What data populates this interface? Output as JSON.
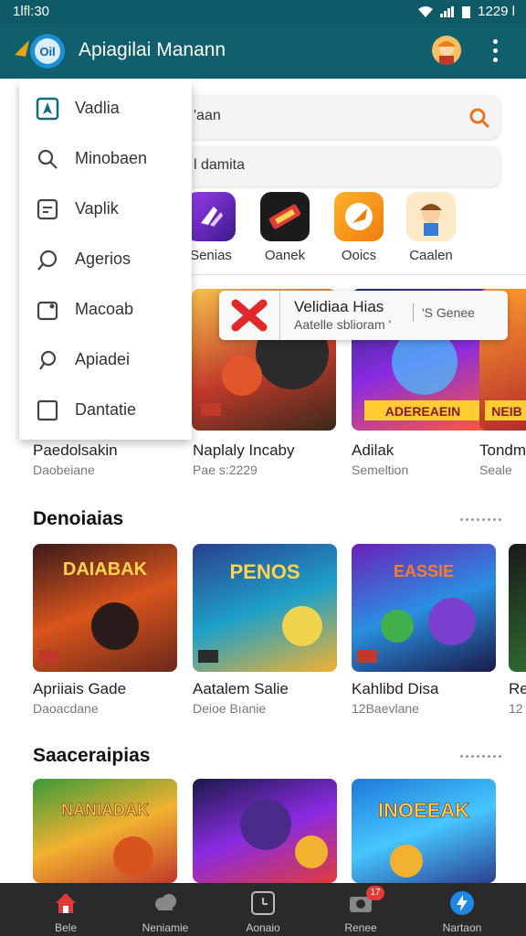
{
  "status_bar": {
    "time": "1lﬂ:30",
    "clock": "1229 l"
  },
  "app_bar": {
    "title": "Apiagilai Manann"
  },
  "search": {
    "query": "'aan",
    "secondary": "l damita"
  },
  "categories": [
    {
      "label": "Senias",
      "icon": "game-purple-icon",
      "color": "#7b2fd0"
    },
    {
      "label": "Oanek",
      "icon": "game-red-icon",
      "color": "#d6283b"
    },
    {
      "label": "Ooics",
      "icon": "rocket-icon",
      "color": "#f39c12"
    },
    {
      "label": "Caalen",
      "icon": "character-icon",
      "color": "#f2d7a7"
    }
  ],
  "drawer": {
    "items": [
      {
        "label": "Vadlia",
        "icon": "compass-icon"
      },
      {
        "label": "Minobaen",
        "icon": "search-icon"
      },
      {
        "label": "Vaplik",
        "icon": "file-icon"
      },
      {
        "label": "Agerios",
        "icon": "chat-icon"
      },
      {
        "label": "Macoab",
        "icon": "image-icon"
      },
      {
        "label": "Apiadei",
        "icon": "comment-icon"
      },
      {
        "label": "Dantatie",
        "icon": "square-icon"
      }
    ]
  },
  "toast": {
    "title": "Velidiaa Hias",
    "subtitle": "Aatelle sblioram '",
    "action": "'S Genee"
  },
  "row1": [
    {
      "name": "Paedolsakin",
      "sub": "Daobeiane"
    },
    {
      "name": "Naplaly Incaby",
      "sub": "Pae s:2229",
      "tag": "DDE"
    },
    {
      "name": "Adilak",
      "sub": "Semeltion",
      "banner": "ADEREAEIN"
    },
    {
      "name": "Tondm",
      "sub": "Seale",
      "banner": "NEIB"
    }
  ],
  "section2": {
    "title": "Denoiaias"
  },
  "row2": [
    {
      "name": "Apriiais Gade",
      "sub": "Daoacdane",
      "banner": "DAIABAK",
      "tag": "DDS"
    },
    {
      "name": "Aatalem Salie",
      "sub": "Deioe Bıanie",
      "banner": "PENOS",
      "tag": "DDC"
    },
    {
      "name": "Kahlibd Disa",
      "sub": "12Baevlane",
      "banner": "EASSIE",
      "tag": "DDS"
    },
    {
      "name": "Re",
      "sub": "12"
    }
  ],
  "section3": {
    "title": "Saaceraipias"
  },
  "row3": [
    {
      "banner": "NANIADAK"
    },
    {
      "banner": ""
    },
    {
      "banner": "INOEEAK"
    }
  ],
  "bottom_nav": [
    {
      "label": "Bele",
      "icon": "home-icon"
    },
    {
      "label": "Neniamie",
      "icon": "cloud-icon"
    },
    {
      "label": "Aonaio",
      "icon": "clock-icon"
    },
    {
      "label": "Renee",
      "icon": "camera-icon",
      "badge": "17"
    },
    {
      "label": "Nartaon",
      "icon": "lightning-icon"
    }
  ],
  "colors": {
    "primary": "#0f5f6c",
    "accent": "#e8731c"
  }
}
